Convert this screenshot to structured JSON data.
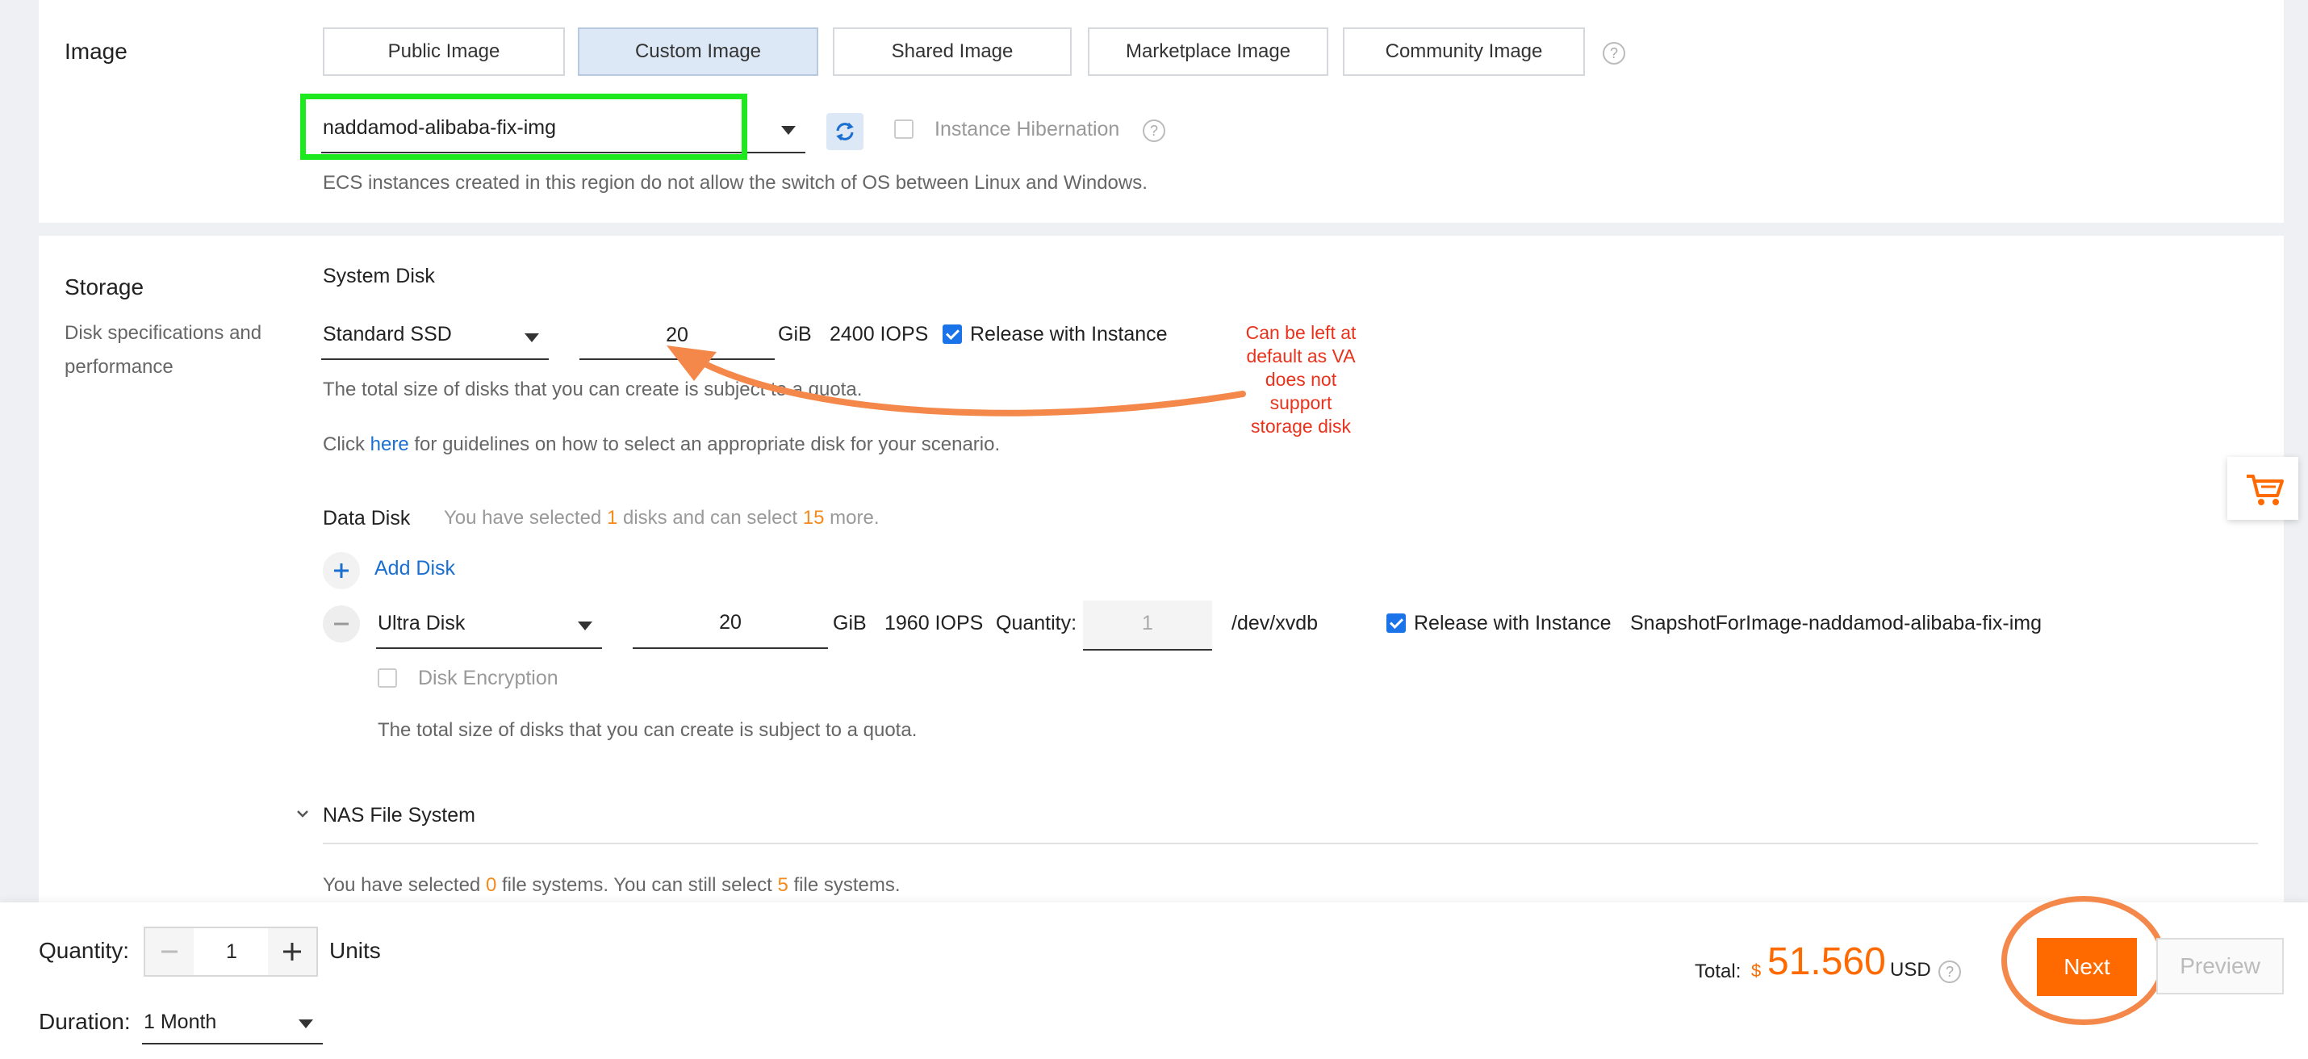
{
  "image": {
    "section_title": "Image",
    "tabs": [
      {
        "label": "Public Image"
      },
      {
        "label": "Custom Image"
      },
      {
        "label": "Shared Image"
      },
      {
        "label": "Marketplace Image"
      },
      {
        "label": "Community Image"
      }
    ],
    "selected_image": "naddamod-alibaba-fix-img",
    "hibernation_label": "Instance Hibernation",
    "note": "ECS instances created in this region do not allow the switch of OS between Linux and Windows."
  },
  "storage": {
    "section_title": "Storage",
    "section_desc_line1": "Disk specifications and",
    "section_desc_line2": "performance",
    "system_disk": {
      "title": "System Disk",
      "type": "Standard SSD",
      "size": "20",
      "unit": "GiB",
      "iops": "2400 IOPS",
      "release_label": "Release with Instance",
      "quota_note": "The total size of disks that you can create is subject to a quota.",
      "guide_prefix": "Click",
      "guide_link": "here",
      "guide_suffix": "for guidelines on how to select an appropriate disk for your scenario."
    },
    "annotation": {
      "line1": "Can be left at",
      "line2": "default as VA",
      "line3": "does not",
      "line4": "support",
      "line5": "storage disk",
      "color": "#e8321c",
      "arrow_color": "#f4884a"
    },
    "data_disk": {
      "title": "Data Disk",
      "selected_prefix": "You have selected",
      "selected_count": "1",
      "selected_mid": "disks and can select",
      "remaining_count": "15",
      "selected_suffix": "more.",
      "add_label": "Add Disk",
      "type": "Ultra Disk",
      "size": "20",
      "unit": "GiB",
      "iops": "1960 IOPS",
      "quantity_label": "Quantity:",
      "quantity_value": "1",
      "device": "/dev/xvdb",
      "release_label": "Release with Instance",
      "snapshot": "SnapshotForImage-naddamod-alibaba-fix-img",
      "encryption_label": "Disk Encryption",
      "quota_note": "The total size of disks that you can create is subject to a quota."
    },
    "nas": {
      "title": "NAS File System",
      "note_prefix": "You have selected",
      "selected_count": "0",
      "note_mid": "file systems. You can still select",
      "remaining_count": "5",
      "note_suffix": "file systems."
    }
  },
  "footer": {
    "quantity_label": "Quantity:",
    "quantity_value": "1",
    "units_label": "Units",
    "duration_label": "Duration:",
    "duration_value": "1 Month",
    "total_label": "Total:",
    "currency_symbol": "$",
    "total_amount": "51.560",
    "currency": "USD",
    "next_label": "Next",
    "preview_label": "Preview",
    "accent_color": "#ff6a00"
  }
}
